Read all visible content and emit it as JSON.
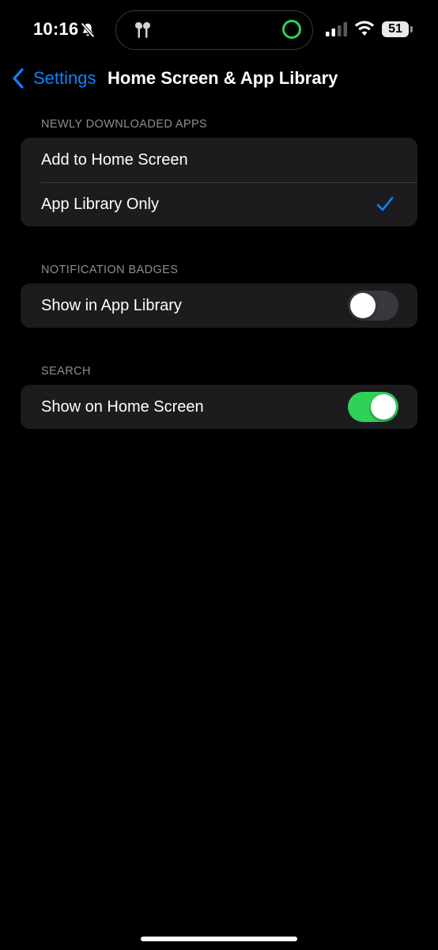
{
  "status_bar": {
    "time": "10:16",
    "battery_level": "51",
    "icons": [
      "bell-slash-icon",
      "airpods-icon",
      "activity-ring-icon",
      "cellular-signal-icon",
      "wifi-icon",
      "battery-icon"
    ],
    "ring_color": "#30d158"
  },
  "nav": {
    "back_label": "Settings",
    "title": "Home Screen & App Library",
    "accent": "#0a84ff"
  },
  "sections": {
    "newly_downloaded": {
      "header": "NEWLY DOWNLOADED APPS",
      "options": [
        {
          "label": "Add to Home Screen",
          "selected": false
        },
        {
          "label": "App Library Only",
          "selected": true
        }
      ]
    },
    "notification_badges": {
      "header": "NOTIFICATION BADGES",
      "row": {
        "label": "Show in App Library",
        "on": false
      }
    },
    "search": {
      "header": "SEARCH",
      "row": {
        "label": "Show on Home Screen",
        "on": true
      }
    }
  },
  "colors": {
    "toggle_on": "#30d158",
    "toggle_off": "#39393d",
    "background": "#000000",
    "cell": "#1c1c1e"
  }
}
